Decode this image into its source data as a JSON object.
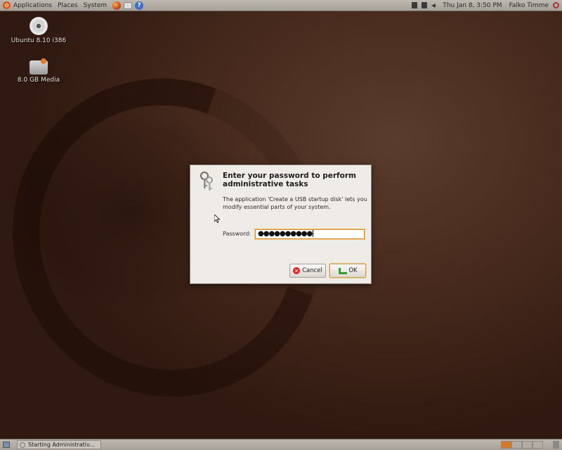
{
  "top_panel": {
    "menus": [
      "Applications",
      "Places",
      "System"
    ],
    "clock": "Thu Jan  8,  3:50 PM",
    "user": "Falko Timme"
  },
  "desktop_icons": [
    {
      "label": "Ubuntu 8.10 i386",
      "icon": "cdrom-icon"
    },
    {
      "label": "8.0 GB Media",
      "icon": "usb-drive-icon"
    }
  ],
  "dialog": {
    "title": "Enter your password to perform administrative tasks",
    "message": "The application 'Create a USB startup disk' lets you modify essential parts of your system.",
    "password_label": "Password:",
    "password_value": "●●●●●●●●●●",
    "cancel_label": "Cancel",
    "ok_label": "OK"
  },
  "bottom_panel": {
    "task_label": "Starting Administrativ..."
  },
  "colors": {
    "accent": "#d98a2a",
    "panel": "#b3ada5"
  }
}
